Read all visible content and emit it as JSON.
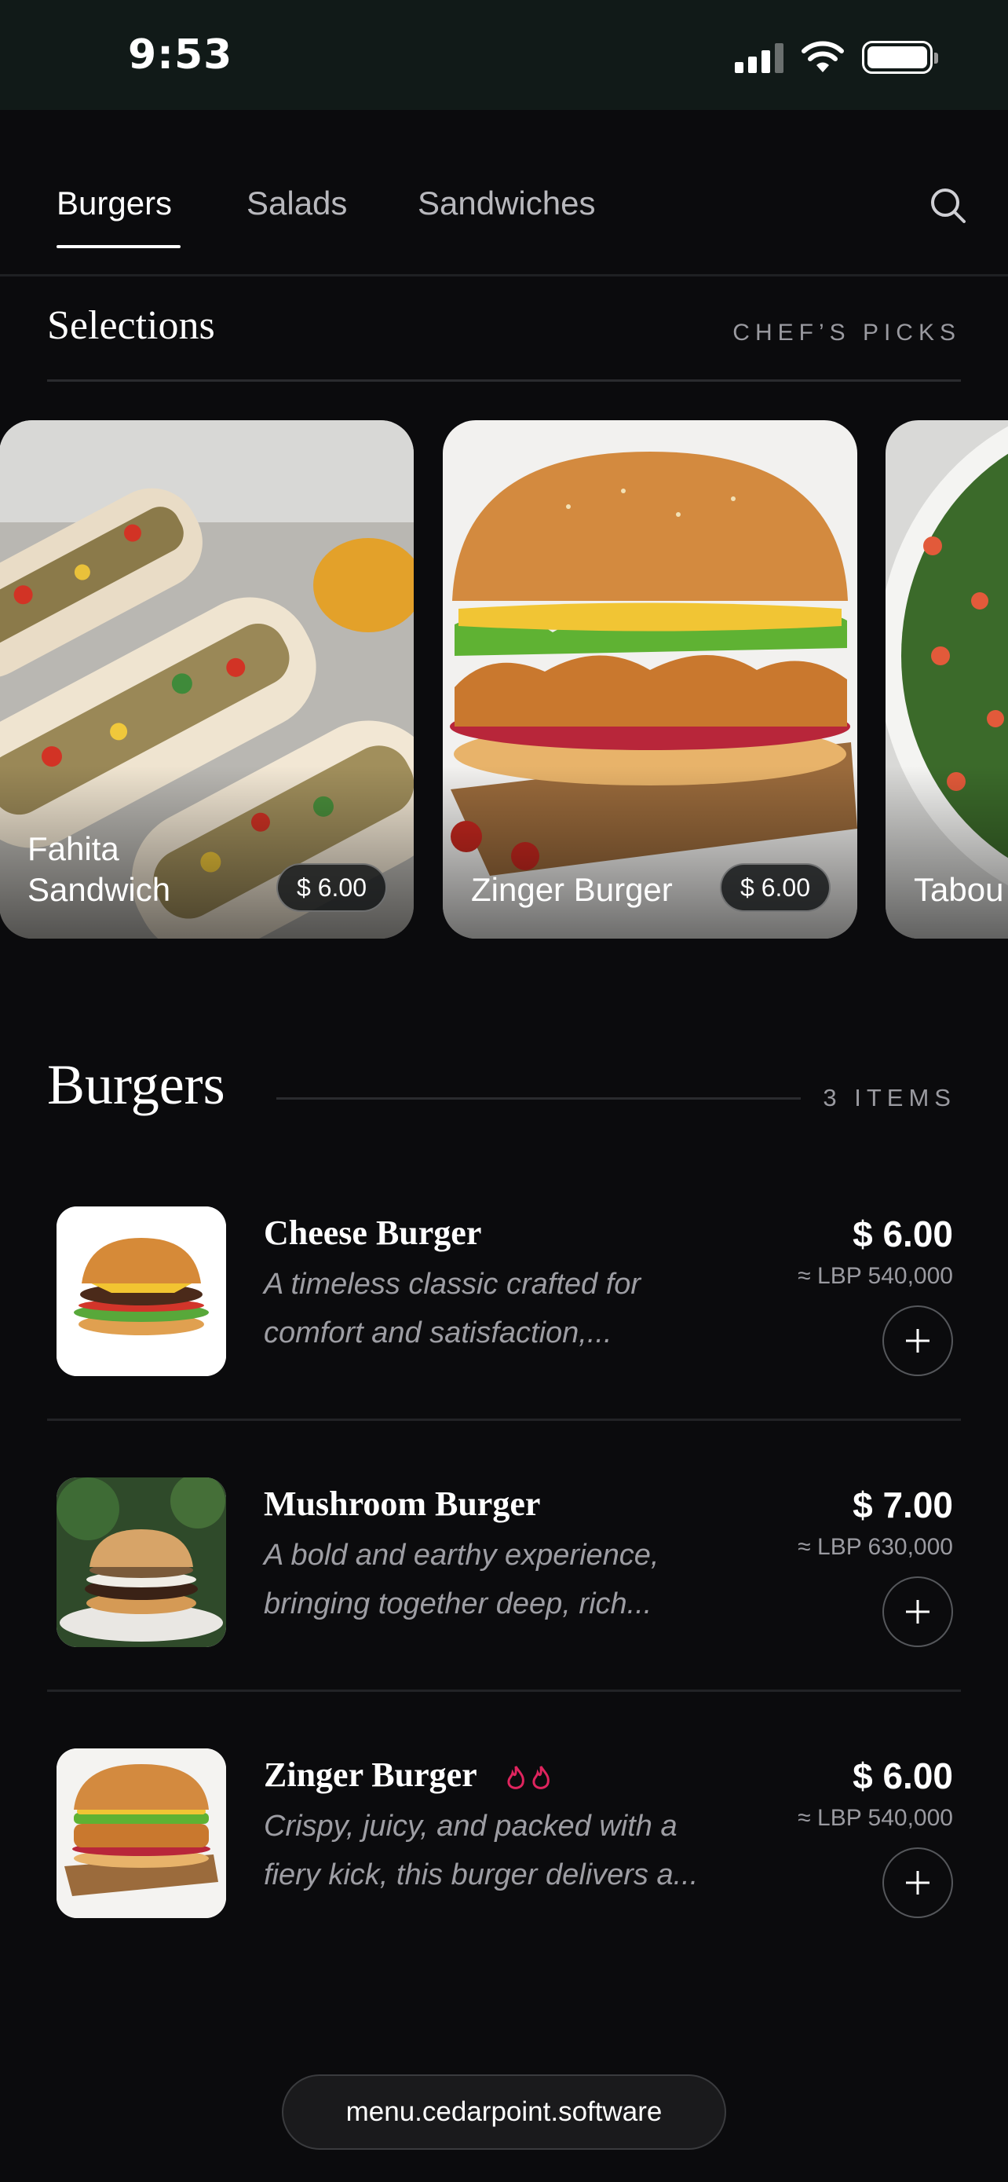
{
  "status": {
    "time": "9:53"
  },
  "tabs": [
    {
      "label": "Burgers",
      "active": true
    },
    {
      "label": "Salads",
      "active": false
    },
    {
      "label": "Sandwiches",
      "active": false
    }
  ],
  "search": {
    "icon": "search-icon"
  },
  "selections": {
    "title": "Selections",
    "subtitle": "CHEF’S PICKS",
    "cards": [
      {
        "title": "Fahita Sandwich",
        "price": "$ 6.00"
      },
      {
        "title": "Zinger Burger",
        "price": "$ 6.00"
      },
      {
        "title": "Tabou",
        "price": ""
      }
    ]
  },
  "burgers": {
    "title": "Burgers",
    "count": "3 ITEMS",
    "items": [
      {
        "name": "Cheese Burger",
        "desc": "A timeless classic crafted for comfort and satisfaction,...",
        "price": "$ 6.00",
        "lbp": "≈ LBP 540,000"
      },
      {
        "name": "Mushroom Burger",
        "desc": "A bold and earthy experience, bringing together deep, rich...",
        "price": "$ 7.00",
        "lbp": "≈ LBP 630,000"
      },
      {
        "name": "Zinger Burger",
        "desc": "Crispy, juicy, and packed with a fiery kick, this burger delivers a...",
        "price": "$ 6.00",
        "lbp": "≈ LBP 540,000",
        "spicy_level": 2
      }
    ]
  },
  "footer": {
    "url": "menu.cedarpoint.software"
  },
  "colors": {
    "background": "#0b0b0d",
    "status_bar": "#111a18",
    "spicy": "#e0245e"
  }
}
